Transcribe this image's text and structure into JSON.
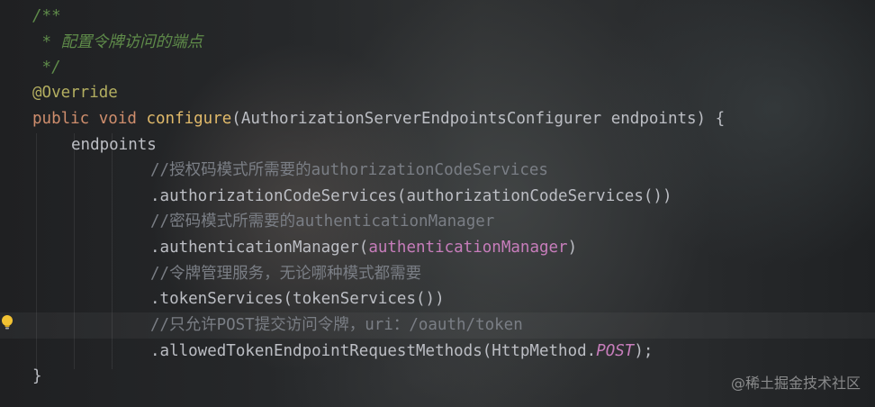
{
  "code": {
    "doc_open": "/**",
    "doc_comment": " * 配置令牌访问的端点",
    "doc_close": " */",
    "annotation": "@Override",
    "kw_public": "public",
    "kw_void": "void",
    "method_name": "configure",
    "params": "(AuthorizationServerEndpointsConfigurer endpoints) {",
    "endpoints": "endpoints",
    "comment_auth_code": "//授权码模式所需要的authorizationCodeServices",
    "call_auth_code": ".authorizationCodeServices(authorizationCodeServices())",
    "comment_password": "//密码模式所需要的authenticationManager",
    "call_auth_manager_prefix": ".authenticationManager(",
    "auth_manager_field": "authenticationManager",
    "close_paren": ")",
    "comment_token_services": "//令牌管理服务，无论哪种模式都需要",
    "call_token_services": ".tokenServices(tokenServices())",
    "comment_allowed": "//只允许POST提交访问令牌，uri：/oauth/token",
    "call_allowed_prefix": ".allowedTokenEndpointRequestMethods(HttpMethod.",
    "post_const": "POST",
    "call_allowed_suffix": ");",
    "closing_brace": "}"
  },
  "gutter": {
    "intention_icon": "lightbulb-icon"
  },
  "watermark": "@稀土掘金技术社区",
  "colors": {
    "keyword": "#cf8e6d",
    "method": "#e0b96a",
    "annotation": "#b3ae60",
    "doc_comment": "#5f8c4a",
    "line_comment": "#7a7e85",
    "field": "#c77dbb",
    "text": "#bcbec4"
  }
}
